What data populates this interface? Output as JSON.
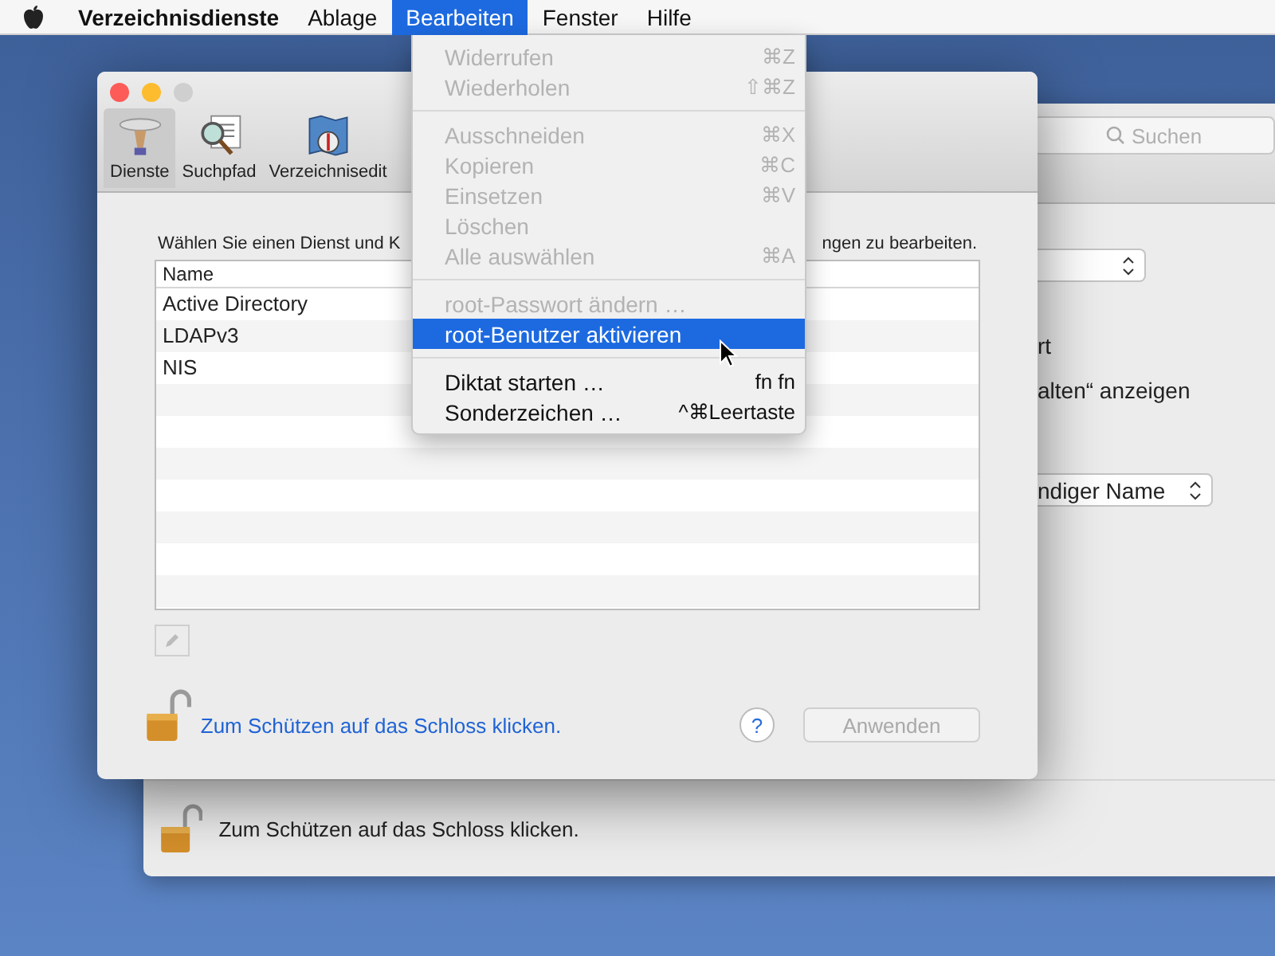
{
  "menubar": {
    "app_name": "Verzeichnisdienste",
    "menus": [
      {
        "label": "Ablage",
        "selected": false
      },
      {
        "label": "Bearbeiten",
        "selected": true
      },
      {
        "label": "Fenster",
        "selected": false
      },
      {
        "label": "Hilfe",
        "selected": false
      }
    ]
  },
  "edit_menu": {
    "items": [
      {
        "kind": "item",
        "label": "Widerrufen",
        "shortcut": "⌘Z",
        "disabled": true,
        "selected": false
      },
      {
        "kind": "item",
        "label": "Wiederholen",
        "shortcut": "⇧⌘Z",
        "disabled": true,
        "selected": false
      },
      {
        "kind": "separator"
      },
      {
        "kind": "item",
        "label": "Ausschneiden",
        "shortcut": "⌘X",
        "disabled": true,
        "selected": false
      },
      {
        "kind": "item",
        "label": "Kopieren",
        "shortcut": "⌘C",
        "disabled": true,
        "selected": false
      },
      {
        "kind": "item",
        "label": "Einsetzen",
        "shortcut": "⌘V",
        "disabled": true,
        "selected": false
      },
      {
        "kind": "item",
        "label": "Löschen",
        "disabled": true,
        "selected": false
      },
      {
        "kind": "item",
        "label": "Alle auswählen",
        "shortcut": "⌘A",
        "disabled": true,
        "selected": false
      },
      {
        "kind": "separator"
      },
      {
        "kind": "item",
        "label": "root-Passwort ändern …",
        "disabled": true,
        "selected": false
      },
      {
        "kind": "item",
        "label": "root-Benutzer aktivieren",
        "disabled": false,
        "selected": true
      },
      {
        "kind": "separator"
      },
      {
        "kind": "item",
        "label": "Diktat starten …",
        "shortcut": "fn fn",
        "disabled": false,
        "selected": false
      },
      {
        "kind": "item",
        "label": "Sonderzeichen …",
        "shortcut": "^⌘Leertaste",
        "disabled": false,
        "selected": false
      }
    ]
  },
  "back_window": {
    "search": {
      "placeholder": "Suchen"
    },
    "texts": [
      "rt",
      "alten“ anzeigen"
    ],
    "popup": "ndiger Name",
    "lock_text": "Zum Schützen auf das Schloss klicken."
  },
  "front_window": {
    "toolbar": [
      {
        "label": "Dienste",
        "selected": true
      },
      {
        "label": "Suchpfad",
        "selected": false
      },
      {
        "label": "Verzeichnisedit",
        "selected": false
      }
    ],
    "instruction": [
      "Wählen Sie einen Dienst und K",
      "ngen zu bearbeiten."
    ],
    "table": {
      "columns": [
        "Name"
      ],
      "rows": [
        "Active Directory",
        "LDAPv3",
        "NIS"
      ]
    },
    "lock_link": "Zum Schützen auf das Schloss klicken.",
    "help": "?",
    "apply_button": {
      "label": "Anwenden",
      "disabled": true
    }
  }
}
